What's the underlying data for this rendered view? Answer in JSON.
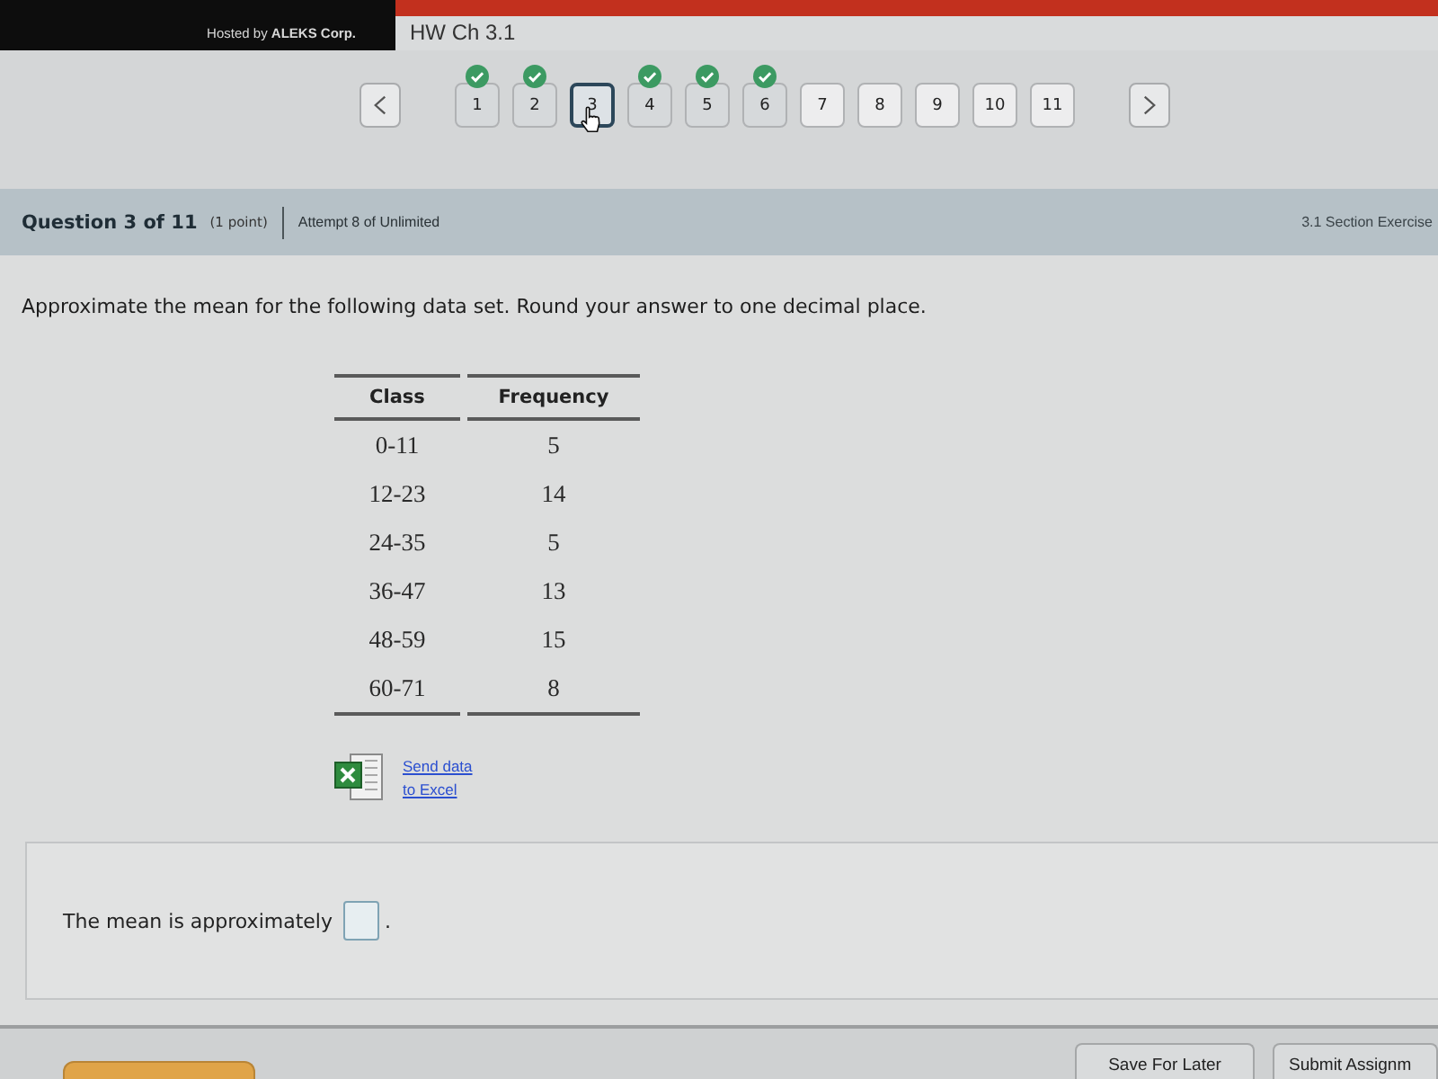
{
  "header": {
    "hosted_by": "Hosted by **ALEKS Corp.**",
    "assignment_title": "HW Ch 3.1"
  },
  "question_nav": {
    "questions": [
      {
        "label": "1",
        "completed": true,
        "selected": false
      },
      {
        "label": "2",
        "completed": true,
        "selected": false
      },
      {
        "label": "3",
        "completed": false,
        "selected": true
      },
      {
        "label": "4",
        "completed": true,
        "selected": false
      },
      {
        "label": "5",
        "completed": true,
        "selected": false
      },
      {
        "label": "6",
        "completed": true,
        "selected": false
      },
      {
        "label": "7",
        "completed": false,
        "selected": false
      },
      {
        "label": "8",
        "completed": false,
        "selected": false
      },
      {
        "label": "9",
        "completed": false,
        "selected": false
      },
      {
        "label": "10",
        "completed": false,
        "selected": false
      },
      {
        "label": "11",
        "completed": false,
        "selected": false
      }
    ]
  },
  "question_header": {
    "title": "Question 3 of 11",
    "points": "(1 point)",
    "attempt": "Attempt 8 of Unlimited",
    "section": "3.1 Section Exercise"
  },
  "prompt": "Approximate the mean for the following data set. Round your answer to one decimal place.",
  "data_table": {
    "columns": [
      "Class",
      "Frequency"
    ],
    "rows": [
      [
        "0-11",
        "5"
      ],
      [
        "12-23",
        "14"
      ],
      [
        "24-35",
        "5"
      ],
      [
        "36-47",
        "13"
      ],
      [
        "48-59",
        "15"
      ],
      [
        "60-71",
        "8"
      ]
    ]
  },
  "excel_link": "Send data to Excel",
  "answer": {
    "label": "The mean is approximately",
    "suffix": "."
  },
  "footer_buttons": [
    {
      "label": "Save For Later"
    },
    {
      "label": "Submit Assignm"
    }
  ]
}
